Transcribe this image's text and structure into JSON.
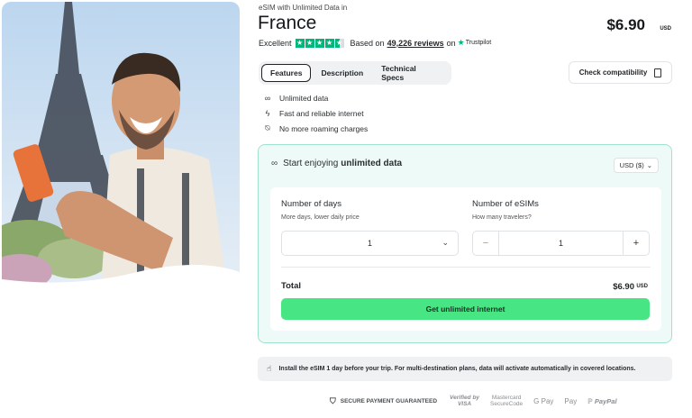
{
  "product": {
    "subtitle": "eSIM with Unlimited Data in",
    "title": "France",
    "price": "$6.90",
    "currency": "USD"
  },
  "rating": {
    "label": "Excellent",
    "based_on": "Based on",
    "reviews": "49,226 reviews",
    "on": "on",
    "source": "Trustpilot",
    "stars": 4.5
  },
  "tabs": [
    "Features",
    "Description",
    "Technical Specs"
  ],
  "check_compatibility": "Check compatibility",
  "features": [
    {
      "icon": "infinity-icon",
      "label": "Unlimited data"
    },
    {
      "icon": "lightning-icon",
      "label": "Fast and reliable internet"
    },
    {
      "icon": "no-roaming-icon",
      "label": "No more roaming charges"
    }
  ],
  "plan": {
    "heading_prefix": "Start enjoying",
    "heading_bold": "unlimited data",
    "currency_select": "USD ($)",
    "days_label": "Number of days",
    "days_hint": "More days, lower daily price",
    "days_value": "1",
    "esims_label": "Number of eSIMs",
    "esims_hint": "How many travelers?",
    "esims_value": "1",
    "minus": "−",
    "plus": "+",
    "total_label": "Total",
    "total_value": "$6.90",
    "total_currency": "USD",
    "cta": "Get unlimited internet"
  },
  "note": "Install the eSIM 1 day before your trip. For multi-destination plans, data will activate automatically in covered locations.",
  "payments": {
    "secure": "SECURE PAYMENT GUARANTEED",
    "verified_top": "Verified by",
    "verified_bottom": "VISA",
    "mc_top": "Mastercard",
    "mc_bottom": "SecureCode",
    "gpay": "G Pay",
    "applepay": "Pay",
    "paypal": "PayPal"
  },
  "colors": {
    "accent_green": "#48e585",
    "card_bg": "#eefaf7",
    "trustpilot": "#00b67a"
  }
}
